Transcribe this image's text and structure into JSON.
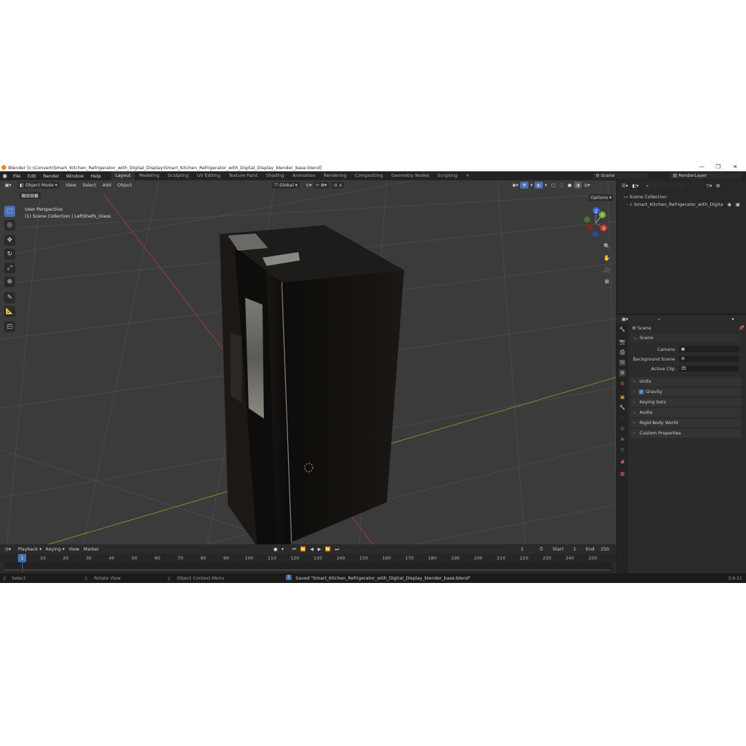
{
  "window": {
    "title": "Blender [c:\\Convert\\Smart_Kitchen_Refrigerator_with_Digital_Display\\Smart_Kitchen_Refrigerator_with_Digital_Display_blender_base.blend]",
    "min_glyph": "—",
    "max_glyph": "❐",
    "close_glyph": "✕"
  },
  "menu": {
    "items": [
      "File",
      "Edit",
      "Render",
      "Window",
      "Help"
    ],
    "tabs": [
      "Layout",
      "Modeling",
      "Sculpting",
      "UV Editing",
      "Texture Paint",
      "Shading",
      "Animation",
      "Rendering",
      "Compositing",
      "Geometry Nodes",
      "Scripting"
    ],
    "active_tab": "Layout",
    "add_tab": "+",
    "scene": "Scene",
    "render_layer": "RenderLayer"
  },
  "viewport": {
    "mode": "Object Mode",
    "menus": [
      "View",
      "Select",
      "Add",
      "Object"
    ],
    "transform_orientation": "Global",
    "options": "Options",
    "perspective": "User Perspective",
    "collection_info": "(1) Scene Collection | LeftShelfs_Glass",
    "gizmo": {
      "x": "X",
      "y": "Y",
      "z": "Z"
    }
  },
  "outliner": {
    "root": "Scene Collection",
    "items": [
      {
        "name": "Smart_Kitchen_Refrigerator_with_Digita"
      }
    ]
  },
  "properties": {
    "header": "Scene",
    "section": "Scene",
    "rows": [
      {
        "label": "Camera"
      },
      {
        "label": "Background Scene"
      },
      {
        "label": "Active Clip"
      }
    ],
    "panels": [
      "Units",
      "Gravity",
      "Keying Sets",
      "Audio",
      "Rigid Body World",
      "Custom Properties"
    ],
    "gravity_checked": true
  },
  "timeline": {
    "menus": [
      "Playback",
      "Keying",
      "View",
      "Marker"
    ],
    "current_frame": "1",
    "start_label": "Start",
    "start": "1",
    "end_label": "End",
    "end": "250",
    "ticks": [
      "1",
      "10",
      "20",
      "30",
      "40",
      "50",
      "60",
      "70",
      "80",
      "90",
      "100",
      "110",
      "120",
      "130",
      "140",
      "150",
      "160",
      "170",
      "180",
      "190",
      "200",
      "210",
      "220",
      "230",
      "240",
      "250"
    ]
  },
  "status": {
    "select": "Select",
    "rotate": "Rotate View",
    "context": "Object Context Menu",
    "message": "Saved \"Smart_Kitchen_Refrigerator_with_Digital_Display_blender_base.blend\"",
    "version": "3.6.11"
  },
  "colors": {
    "accent": "#4772b3",
    "x_axis": "#c93a3a",
    "y_axis": "#7aa83a",
    "z_axis": "#3a6ad1"
  }
}
